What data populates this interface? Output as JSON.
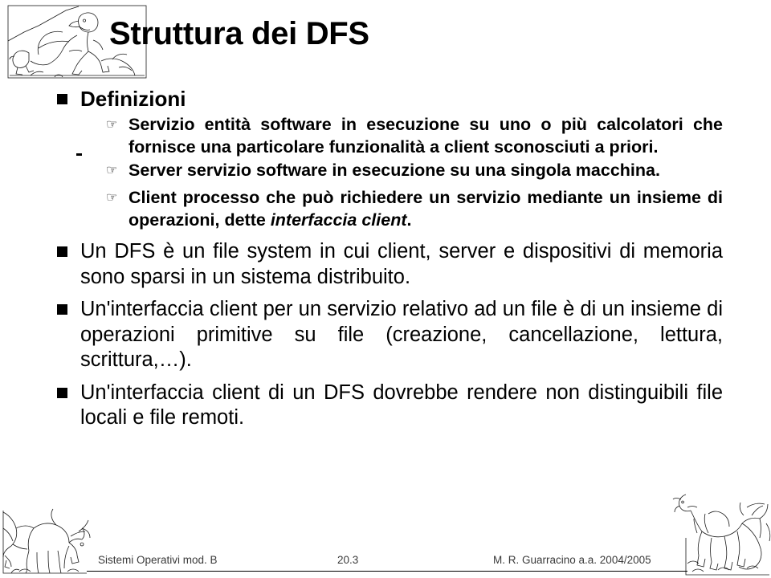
{
  "slide": {
    "title": "Struttura dei DFS",
    "page_label": "20.3",
    "bullet_square_icon": "filled-square-bullet",
    "sub_bullet_icon": "pointing-hand-bullet",
    "accent_color": "#000000",
    "background_color": "#ffffff"
  },
  "content": {
    "heading_bullet": "Definizioni",
    "definitions": [
      {
        "text": "Servizio entità software in esecuzione su uno o più calcolatori che fornisce una particolare funzionalità a client sconosciuti a priori."
      },
      {
        "text": "Server servizio software in esecuzione su una singola macchina."
      },
      {
        "text_before": "Client processo che può richiedere un servizio mediante un insieme di operazioni, dette ",
        "emphasis": "interfaccia client",
        "text_after": "."
      }
    ],
    "paragraphs": [
      "Un DFS è un file system in cui client, server e dispositivi di memoria sono sparsi in un sistema distribuito.",
      "Un'interfaccia client per un servizio relativo ad un file è di un insieme di operazioni primitive su file (creazione, cancellazione, lettura, scrittura,…).",
      "Un'interfaccia client di un DFS dovrebbe rendere non distinguibili file locali e file remoti."
    ]
  },
  "footer": {
    "left": "Sistemi Operativi mod. B",
    "center": "20.3",
    "right": "M. R. Guarracino a.a. 2004/2005"
  },
  "decorations": {
    "top_left": "tyrannosaurus-line-art",
    "bottom_left": "triceratops-line-art",
    "bottom_right": "brachiosaurus-line-art"
  }
}
